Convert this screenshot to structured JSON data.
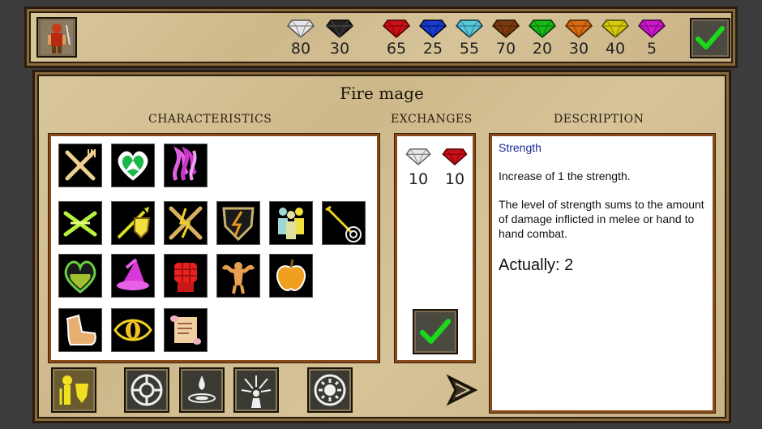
{
  "header": {
    "hero_portrait_icon": "warrior-portrait",
    "confirm_icon": "checkmark",
    "gems": [
      {
        "name": "white",
        "color": "#e8e8e8",
        "count": "80"
      },
      {
        "name": "black",
        "color": "#222222",
        "count": "30"
      },
      {
        "name": "red",
        "color": "#c8101a",
        "count": "65"
      },
      {
        "name": "blue",
        "color": "#1a3ad0",
        "count": "25"
      },
      {
        "name": "cyan",
        "color": "#58c8d8",
        "count": "55"
      },
      {
        "name": "brown",
        "color": "#7a3a10",
        "count": "70"
      },
      {
        "name": "green",
        "color": "#1ab81a",
        "count": "20"
      },
      {
        "name": "orange",
        "color": "#d86a10",
        "count": "30"
      },
      {
        "name": "yellow",
        "color": "#d8c810",
        "count": "40"
      },
      {
        "name": "purple",
        "color": "#c818c8",
        "count": "5"
      }
    ]
  },
  "main": {
    "title": "Fire mage",
    "characteristics_label": "CHARACTERISTICS",
    "exchanges_label": "EXCHANGES",
    "description_label": "DESCRIPTION"
  },
  "characteristics": {
    "icons": [
      "crossed-swords-fork-icon",
      "green-heart-icon",
      "purple-flame-icon",
      "crossed-blades-icon",
      "arrow-shield-icon",
      "crossed-swords-lightning-icon",
      "lightning-shield-icon",
      "group-icon",
      "arrow-target-icon",
      "heart-potion-icon",
      "wizard-hat-icon",
      "red-fist-icon",
      "strongman-icon",
      "apple-icon",
      "boot-icon",
      "eye-icon",
      "scroll-icon"
    ]
  },
  "exchanges": {
    "from_gem": "white",
    "to_gem": "red",
    "from_amount": "10",
    "to_amount": "10"
  },
  "description": {
    "title": "Strength",
    "line1": "Increase of 1 the strength.",
    "line2": "The level of strength sums to the amount of damage inflicted in melee or hand to hand combat.",
    "actual": "Actually: 2"
  },
  "bottom": {
    "buttons": [
      "knight-shield-icon",
      "compass-wheel-icon",
      "water-drop-icon",
      "burst-figure-icon",
      "sun-gear-icon",
      "next-arrow-icon"
    ]
  }
}
